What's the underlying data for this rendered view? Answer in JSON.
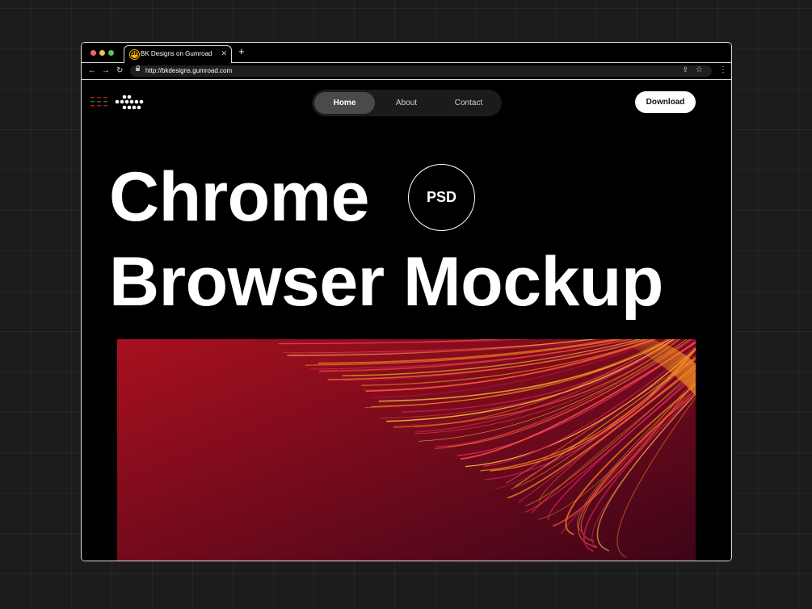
{
  "browser": {
    "tab": {
      "title": "BK Designs on Gumroad",
      "favicon_text": "BK",
      "close_icon": "close-icon"
    },
    "new_tab": "+",
    "address_bar": {
      "url": "http://bkdesigns.gumroad.com"
    },
    "icons": [
      "back-arrow-icon",
      "forward-arrow-icon",
      "reload-icon",
      "lock-icon",
      "share-icon",
      "star-icon",
      "kebab-menu-icon"
    ]
  },
  "site": {
    "nav": {
      "items": [
        "Home",
        "About",
        "Contact"
      ],
      "active": "Home"
    },
    "download_label": "Download",
    "headline": {
      "line1": "Chrome",
      "line2": "Browser Mockup"
    },
    "badge": "PSD"
  },
  "colors": {
    "background": "#1c1c1c",
    "page": "#000000",
    "hero_red": "#a0101e",
    "hero_dark": "#4a061a",
    "streak_orange": "#f58a1f",
    "streak_pink": "#e0246a"
  }
}
